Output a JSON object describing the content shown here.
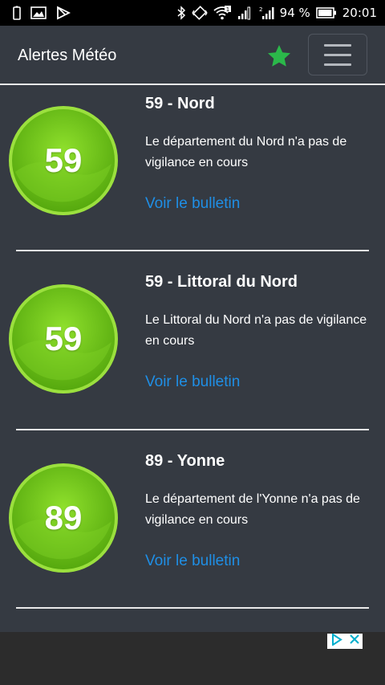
{
  "status_bar": {
    "battery_percent": "94 %",
    "time": "20:01",
    "notification_icons": [
      "battery-indicator-icon",
      "image-icon",
      "store-icon"
    ],
    "system_icons": [
      "bluetooth-icon",
      "vibrate-icon",
      "wifi-icon",
      "sim1-signal-icon",
      "sim2-signal-icon",
      "battery-icon"
    ]
  },
  "header": {
    "title": "Alertes Météo",
    "favorite_icon": "star-icon",
    "menu_icon": "hamburger-menu-icon",
    "star_color": "#2bb84a"
  },
  "alerts": [
    {
      "number": "59",
      "title": "59 - Nord",
      "description": "Le département du Nord n'a pas de vigilance en cours",
      "link": "Voir le bulletin",
      "level_color": "#6dc31a"
    },
    {
      "number": "59",
      "title": "59 - Littoral du Nord",
      "description": "Le Littoral du Nord n'a pas de vigilance en cours",
      "link": "Voir le bulletin",
      "level_color": "#6dc31a"
    },
    {
      "number": "89",
      "title": "89 - Yonne",
      "description": "Le département de l'Yonne n'a pas de vigilance en cours",
      "link": "Voir le bulletin",
      "level_color": "#6dc31a"
    }
  ],
  "ad": {
    "adchoices_icon": "adchoices-icon",
    "close_icon": "close-icon"
  }
}
